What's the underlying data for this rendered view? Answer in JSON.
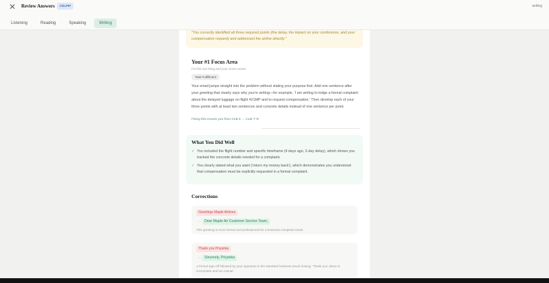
{
  "header": {
    "title": "Review Answers",
    "badge": "CELPIP",
    "mode": "writing",
    "close_glyph": "✕",
    "tabs": [
      {
        "label": "Listening",
        "active": false
      },
      {
        "label": "Reading",
        "active": false
      },
      {
        "label": "Speaking",
        "active": false
      },
      {
        "label": "Writing",
        "active": true
      }
    ]
  },
  "quote": {
    "text": "\"You correctly identified all three required points (the delay, the impact on your conference, and your compensation request) and addressed the airline directly.\""
  },
  "focus": {
    "title": "Your #1 Focus Area",
    "subtitle": "Fix this one thing and your score moves",
    "tag": "Task Fulfillment",
    "body": "Your email jumps straight into the problem without stating your purpose first. Add one sentence after your greeting that clearly says why you're writing—for example, 'I am writing to lodge a formal complaint about the delayed luggage on flight 421MP and to request compensation.' Then develop each of your three points with at least two sentences and concrete details instead of one sentence per point.",
    "link": "Fixing this moves you from CLB 6 → CLB 7–8"
  },
  "did_well": {
    "title": "What You Did Well",
    "check_glyph": "✓",
    "items": [
      "You included the flight number and specific timeframe (4 days ago, 2-day delay), which shows you tracked the concrete details needed for a complaint.",
      "You clearly stated what you want ('return my money back'), which demonstrates you understood that compensation must be explicitly requested in a formal complaint."
    ]
  },
  "corrections": {
    "title": "Corrections",
    "arrow_glyph": "→",
    "items": [
      {
        "wrong": "Greetings Maple Airlines",
        "right": "Dear Maple Air Customer Service Team,",
        "note": "This greeting is more formal and professional for a business complaint email."
      },
      {
        "wrong": "Thank you Priyanka",
        "right": "Sincerely, Priyanka",
        "note": "A formal sign-off followed by your signature is the standard business email closing; 'Thank you' alone is incomplete and too casual."
      }
    ]
  }
}
